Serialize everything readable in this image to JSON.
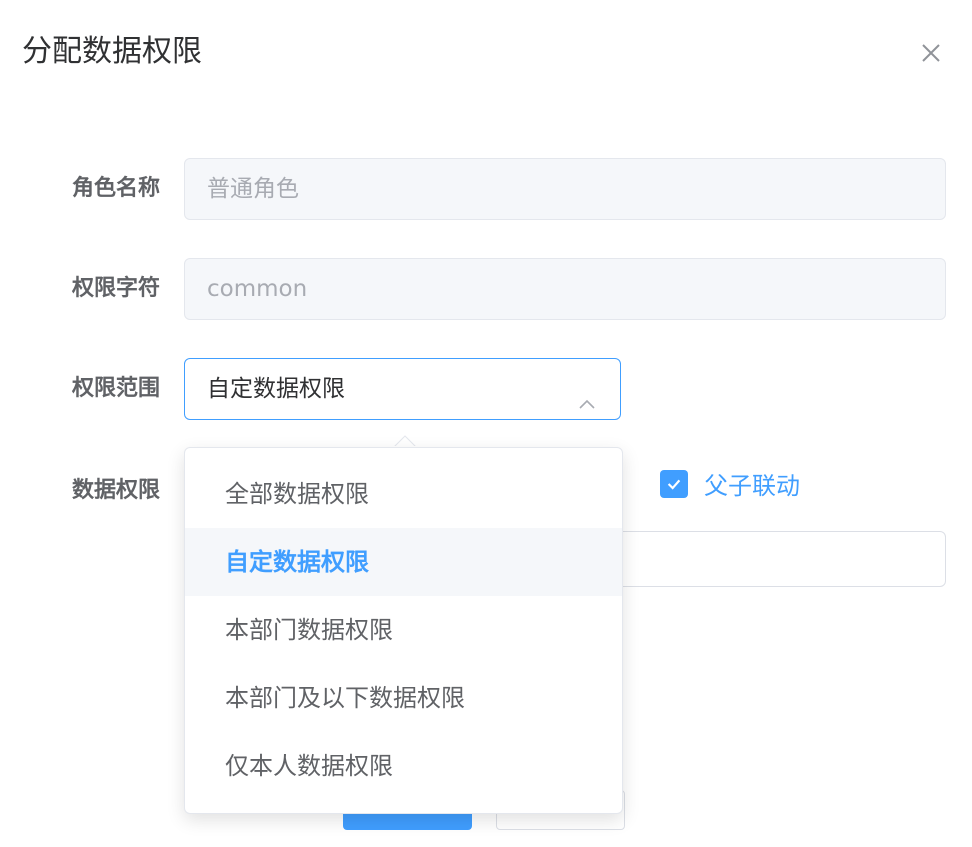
{
  "dialog": {
    "title": "分配数据权限",
    "close_icon": "close-icon"
  },
  "form": {
    "role_name_label": "角色名称",
    "role_name_value": "普通角色",
    "role_key_label": "权限字符",
    "role_key_value": "common",
    "scope_label": "权限范围",
    "scope_value": "自定数据权限",
    "data_scope_label": "数据权限",
    "linkage_label": "父子联动",
    "linkage_checked": true
  },
  "dropdown": {
    "options": [
      "全部数据权限",
      "自定数据权限",
      "本部门数据权限",
      "本部门及以下数据权限",
      "仅本人数据权限"
    ],
    "selected_index": 1
  },
  "colors": {
    "accent": "#409eff",
    "disabled_bg": "#f5f7fa",
    "text": "#303133"
  }
}
